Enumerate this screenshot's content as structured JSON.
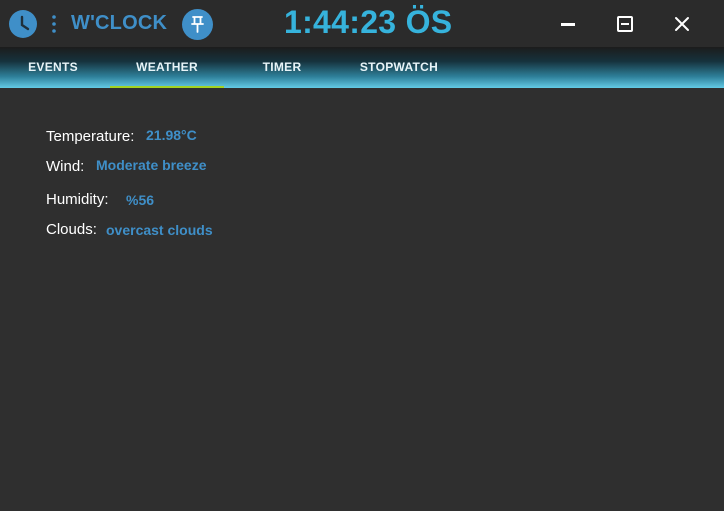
{
  "app": {
    "title": "W'CLOCK",
    "time": "1:44:23 ÖS"
  },
  "icons": {
    "clock": "clock-icon",
    "menu": "vertical-dots-icon",
    "pin": "pin-icon",
    "minimize": "minimize-icon",
    "maximize": "maximize-icon",
    "close": "close-icon"
  },
  "tabs": [
    {
      "label": "EVENTS",
      "active": false
    },
    {
      "label": "WEATHER",
      "active": true
    },
    {
      "label": "TIMER",
      "active": false
    },
    {
      "label": "STOPWATCH",
      "active": false
    }
  ],
  "weather": {
    "temperature": {
      "label": "Temperature:",
      "value": "21.98°C"
    },
    "wind": {
      "label": "Wind:",
      "value": "Moderate breeze"
    },
    "humidity": {
      "label": "Humidity:",
      "value": "%56"
    },
    "clouds": {
      "label": "Clouds:",
      "value": "overcast clouds"
    }
  },
  "colors": {
    "background": "#2f2f2f",
    "titlebar": "#2b2b2b",
    "accent_blue": "#3f8fc8",
    "time_cyan": "#36b3dc",
    "tab_indicator": "#a3d321",
    "text_white": "#ffffff"
  }
}
